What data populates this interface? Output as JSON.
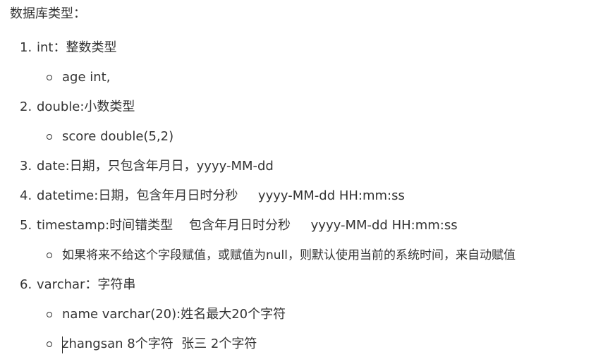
{
  "heading": "数据库类型：",
  "items": [
    {
      "num": "1.",
      "text": "int：整数类型"
    },
    {
      "num": "2.",
      "text": "double:小数类型"
    },
    {
      "num": "3.",
      "text": "date:日期，只包含年月日，yyyy-MM-dd"
    },
    {
      "num": "4.",
      "text": "datetime:日期，包含年月日时分秒     yyyy-MM-dd HH:mm:ss"
    },
    {
      "num": "5.",
      "text": "timestamp:时间错类型    包含年月日时分秒     yyyy-MM-dd HH:mm:ss"
    },
    {
      "num": "6.",
      "text": "varchar：字符串"
    }
  ],
  "subitems": {
    "int": [
      "age int,"
    ],
    "double": [
      "score double(5,2)"
    ],
    "timestamp": [
      "如果将来不给这个字段赋值，或赋值为null，则默认使用当前的系统时间，来自动赋值"
    ],
    "varchar": [
      "name varchar(20):姓名最大20个字符",
      "zhangsan 8个字符  张三 2个字符"
    ]
  }
}
